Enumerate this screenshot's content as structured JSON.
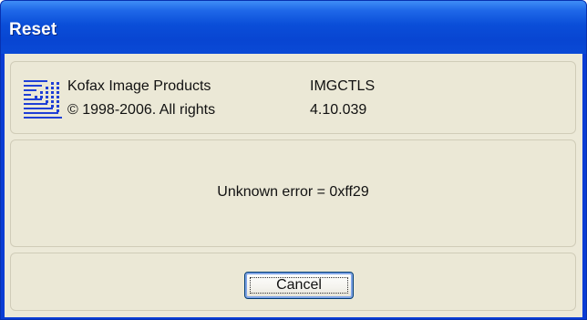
{
  "window": {
    "title": "Reset"
  },
  "info": {
    "company": "Kofax Image Products",
    "copyright": "© 1998-2006.  All rights",
    "module": "IMGCTLS",
    "version": "4.10.039"
  },
  "message": {
    "text": "Unknown error = 0xff29"
  },
  "buttons": {
    "cancel_label": "Cancel"
  },
  "colors": {
    "titlebar": "#0a4ed8",
    "dialog_face": "#ece9d8",
    "logo": "#1f3fd6"
  }
}
